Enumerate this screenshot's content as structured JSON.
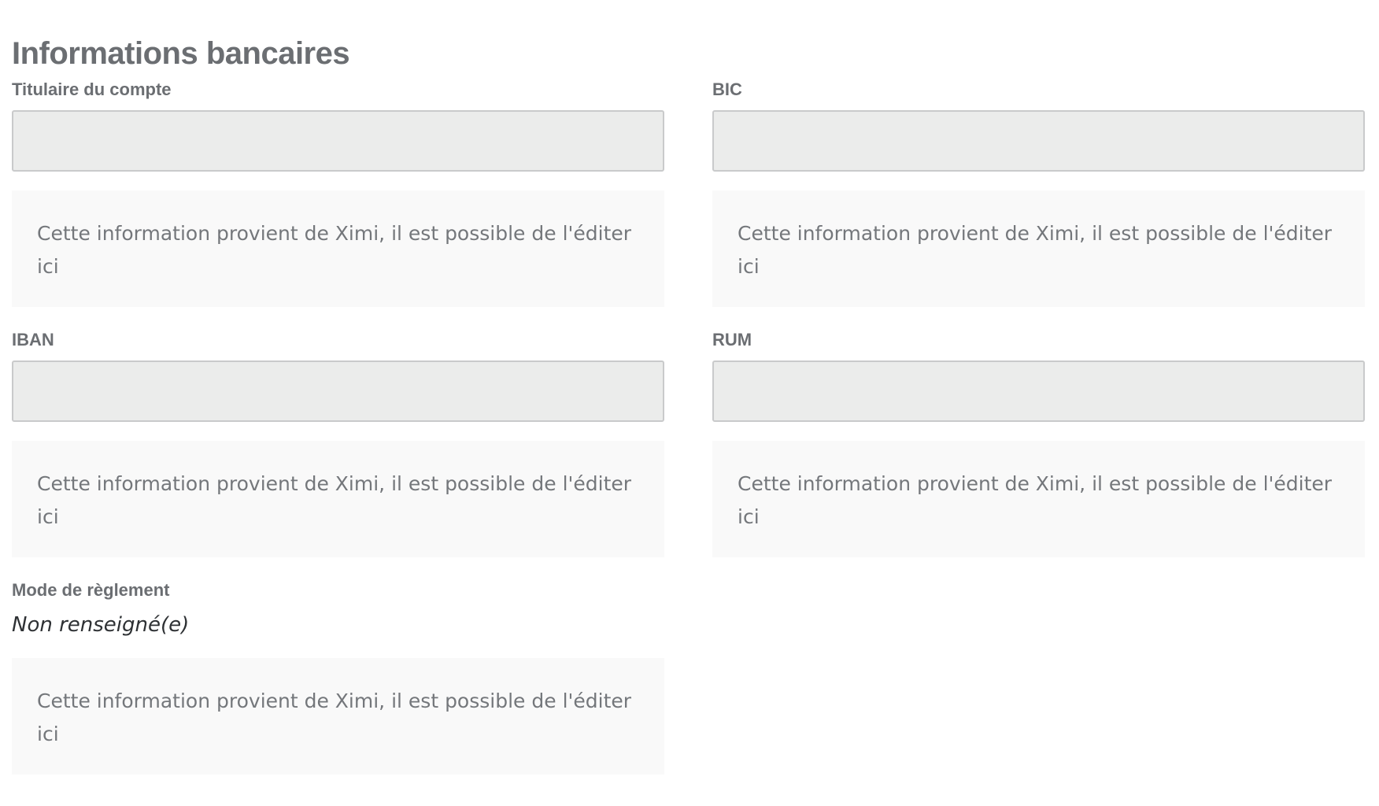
{
  "section": {
    "title": "Informations bancaires"
  },
  "fields": {
    "account_holder": {
      "label": "Titulaire du compte",
      "value": "",
      "info": "Cette information provient de Ximi, il est possible de l'éditer ici"
    },
    "bic": {
      "label": "BIC",
      "value": "",
      "info": "Cette information provient de Ximi, il est possible de l'éditer ici"
    },
    "iban": {
      "label": "IBAN",
      "value": "",
      "info": "Cette information provient de Ximi, il est possible de l'éditer ici"
    },
    "rum": {
      "label": "RUM",
      "value": "",
      "info": "Cette information provient de Ximi, il est possible de l'éditer ici"
    },
    "payment_mode": {
      "label": "Mode de règlement",
      "value": "Non renseigné(e)",
      "info": "Cette information provient de Ximi, il est possible de l'éditer ici"
    }
  },
  "colors": {
    "input_background": "#ebeceb",
    "input_border": "#c9cacb",
    "info_background": "#f9f9f9",
    "label_text": "#6b6e72"
  }
}
